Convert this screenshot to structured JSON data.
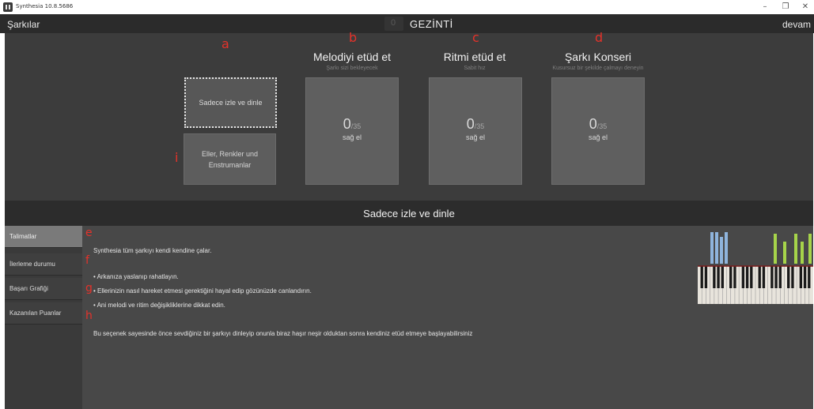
{
  "window": {
    "title": "Synthesia 10.8.5686",
    "minimize": "–",
    "maximize": "❐",
    "close": "✕"
  },
  "nav": {
    "back": "Şarkılar",
    "title_digit": "0",
    "title": "GEZİNTİ",
    "next": "devam"
  },
  "annotations": [
    "a",
    "b",
    "c",
    "d",
    "e",
    "f",
    "g",
    "h",
    "i"
  ],
  "modes": {
    "watch_label": "Sadece izle ve dinle",
    "hands_label_1": "Eller, Renkler und",
    "hands_label_2": "Enstrumanlar",
    "cards": [
      {
        "title": "Melodiyi etüd et",
        "subtitle": "Şarkı sizi bekleyecek",
        "score": "0",
        "total": "/35",
        "hand": "sağ el"
      },
      {
        "title": "Ritmi etüd et",
        "subtitle": "Sabit hız",
        "score": "0",
        "total": "/35",
        "hand": "sağ el"
      },
      {
        "title": "Şarkı Konseri",
        "subtitle": "Kusursuz bir şekilde çalmayı deneyin",
        "score": "0",
        "total": "/35",
        "hand": "sağ el"
      }
    ]
  },
  "section": {
    "title": "Sadece izle ve dinle"
  },
  "sidebar": {
    "items": [
      {
        "label": "Talimatlar",
        "active": true
      },
      {
        "label": "İlerleme durumu",
        "active": false
      },
      {
        "label": "Başarı Grafiği",
        "active": false
      },
      {
        "label": "Kazanılan Puanlar",
        "active": false
      }
    ]
  },
  "content": {
    "intro": "Synthesia tüm şarkıyı kendi kendine çalar.",
    "bullets": [
      "• Arkanıza yaslanıp rahatlayın.",
      "• Ellerinizin nasıl hareket etmesi gerektiğini hayal edip gözünüzde canlandırın.",
      "• Ani melodi ve ritim değişikliklerine dikkat edin."
    ],
    "footer": "Bu seçenek sayesinde önce sevdiğiniz bir şarkıyı dinleyip onunla biraz haşır neşir olduktan sonra kendiniz etüd etmeye başlayabilirsiniz"
  },
  "colors": {
    "accent_red": "#e5322a",
    "note_blue": "#8fb4dc",
    "note_green": "#a6d44a"
  }
}
